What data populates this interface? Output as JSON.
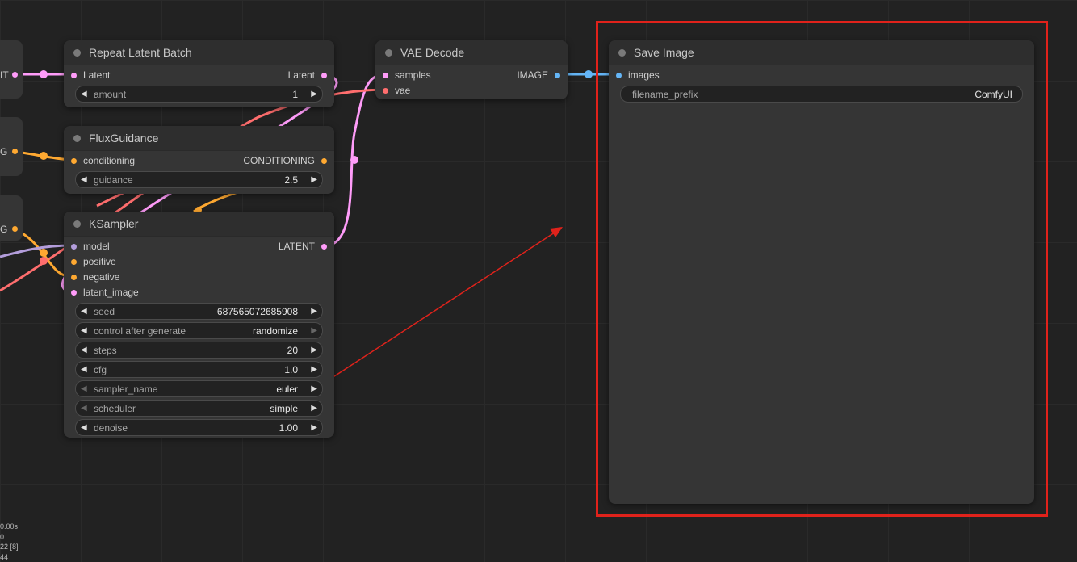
{
  "colors": {
    "latent": "#ff9cf9",
    "conditioning": "#ffa931",
    "model": "#b39ddb",
    "vae": "#ff6e6e",
    "image": "#64b5f6",
    "annotation": "#e0221b"
  },
  "left_stubs": [
    {
      "label": "IT"
    },
    {
      "label": "G"
    },
    {
      "label": "G"
    }
  ],
  "nodes": {
    "repeat_latent_batch": {
      "title": "Repeat Latent Batch",
      "input": "Latent",
      "output": "Latent",
      "widgets": [
        {
          "name": "amount",
          "value": "1"
        }
      ]
    },
    "flux_guidance": {
      "title": "FluxGuidance",
      "input": "conditioning",
      "output": "CONDITIONING",
      "widgets": [
        {
          "name": "guidance",
          "value": "2.5"
        }
      ]
    },
    "ksampler": {
      "title": "KSampler",
      "inputs": [
        "model",
        "positive",
        "negative",
        "latent_image"
      ],
      "output": "LATENT",
      "widgets": [
        {
          "name": "seed",
          "value": "687565072685908"
        },
        {
          "name": "control after generate",
          "value": "randomize"
        },
        {
          "name": "steps",
          "value": "20"
        },
        {
          "name": "cfg",
          "value": "1.0"
        },
        {
          "name": "sampler_name",
          "value": "euler"
        },
        {
          "name": "scheduler",
          "value": "simple"
        },
        {
          "name": "denoise",
          "value": "1.00"
        }
      ]
    },
    "vae_decode": {
      "title": "VAE Decode",
      "inputs": [
        "samples",
        "vae"
      ],
      "output": "IMAGE"
    },
    "save_image": {
      "title": "Save Image",
      "input": "images",
      "widgets": [
        {
          "name": "filename_prefix",
          "value": "ComfyUI"
        }
      ]
    }
  },
  "stats": [
    "0.00s",
    "0",
    "22 [8]",
    "44"
  ]
}
